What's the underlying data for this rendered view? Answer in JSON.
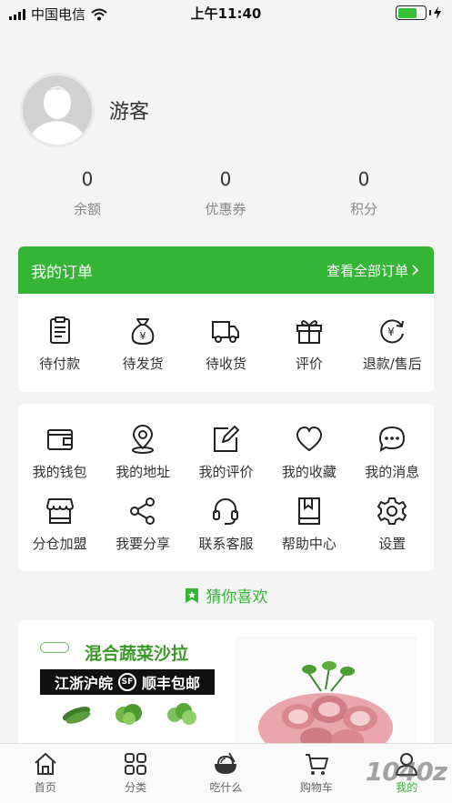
{
  "status_bar": {
    "carrier": "中国电信",
    "time": "上午11:40"
  },
  "profile": {
    "nickname": "游客"
  },
  "stats": [
    {
      "value": "0",
      "label": "余额"
    },
    {
      "value": "0",
      "label": "优惠券"
    },
    {
      "value": "0",
      "label": "积分"
    }
  ],
  "orders": {
    "title": "我的订单",
    "view_all": "查看全部订单",
    "items": [
      {
        "label": "待付款",
        "icon": "clipboard-icon"
      },
      {
        "label": "待发货",
        "icon": "money-bag-icon"
      },
      {
        "label": "待收货",
        "icon": "truck-icon"
      },
      {
        "label": "评价",
        "icon": "gift-icon"
      },
      {
        "label": "退款/售后",
        "icon": "refund-icon"
      }
    ]
  },
  "tools": [
    {
      "label": "我的钱包",
      "icon": "wallet-icon"
    },
    {
      "label": "我的地址",
      "icon": "location-pin-icon"
    },
    {
      "label": "我的评价",
      "icon": "edit-icon"
    },
    {
      "label": "我的收藏",
      "icon": "heart-icon"
    },
    {
      "label": "我的消息",
      "icon": "message-icon"
    },
    {
      "label": "分仓加盟",
      "icon": "store-icon"
    },
    {
      "label": "我要分享",
      "icon": "share-icon"
    },
    {
      "label": "联系客服",
      "icon": "headset-icon"
    },
    {
      "label": "帮助中心",
      "icon": "book-icon"
    },
    {
      "label": "设置",
      "icon": "gear-icon"
    }
  ],
  "guess": {
    "title": "猜你喜欢",
    "icon": "bookmark-star-icon"
  },
  "product1": {
    "headline": "混合蔬菜沙拉",
    "strip_text": "江浙沪皖",
    "sf_mark": "SF",
    "shipping": "顺丰包邮"
  },
  "tabbar": [
    {
      "label": "首页",
      "icon": "home-icon",
      "active": false
    },
    {
      "label": "分类",
      "icon": "grid-icon",
      "active": false
    },
    {
      "label": "吃什么",
      "icon": "bowl-icon",
      "active": false
    },
    {
      "label": "购物车",
      "icon": "cart-icon",
      "active": false
    },
    {
      "label": "我的",
      "icon": "user-icon",
      "active": true
    }
  ],
  "watermark": "1040z",
  "colors": {
    "brand_green": "#35b536",
    "background": "#f4f4f4",
    "battery_green": "#35c236"
  }
}
